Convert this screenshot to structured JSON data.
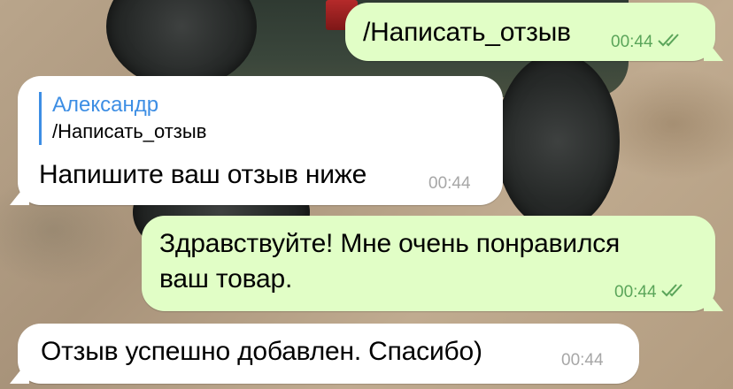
{
  "chat": {
    "messages": [
      {
        "direction": "out",
        "text": "/Написать_отзыв",
        "time": "00:44",
        "status": "read"
      },
      {
        "direction": "in",
        "reply_to": {
          "author": "Александр",
          "text": "/Написать_отзыв"
        },
        "text": "Напишите ваш отзыв ниже",
        "time": "00:44"
      },
      {
        "direction": "out",
        "lines": [
          "Здравствуйте! Мне очень понравился",
          "ваш товар."
        ],
        "time": "00:44",
        "status": "read"
      },
      {
        "direction": "in",
        "text": "Отзыв успешно добавлен. Спасибо)",
        "time": "00:44"
      }
    ]
  },
  "theme": {
    "outgoing_bubble": "#e1fec6",
    "incoming_bubble": "#ffffff",
    "accent": "#3d8ee4",
    "read_check_color": "#5ba55a",
    "icons": {
      "read_status": "double-check-icon"
    }
  }
}
